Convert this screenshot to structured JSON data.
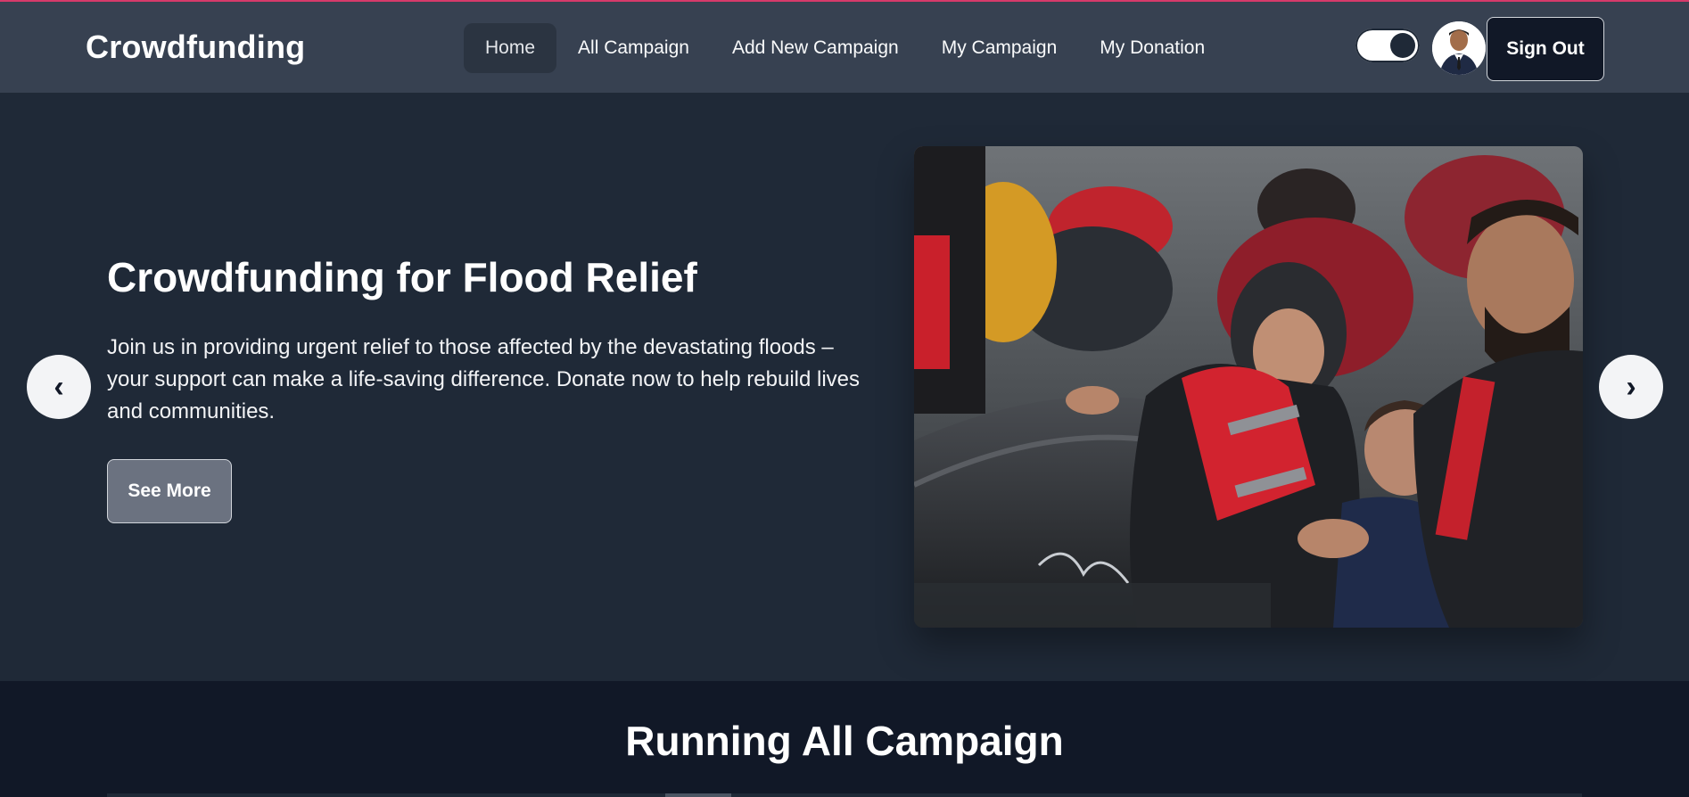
{
  "navbar": {
    "brand": "Crowdfunding",
    "links": [
      {
        "label": "Home",
        "active": true
      },
      {
        "label": "All Campaign",
        "active": false
      },
      {
        "label": "Add New Campaign",
        "active": false
      },
      {
        "label": "My Campaign",
        "active": false
      },
      {
        "label": "My Donation",
        "active": false
      }
    ],
    "theme_toggle_icon": "toggle-switch-icon",
    "avatar_icon": "user-avatar",
    "sign_out_label": "Sign Out"
  },
  "hero": {
    "title": "Crowdfunding for Flood Relief",
    "description": "Join us in providing urgent relief to those affected by the devastating floods – your support can make a life-saving difference. Donate now to help rebuild lives and communities.",
    "button_label": "See More",
    "prev_arrow": "‹",
    "next_arrow": "›",
    "image_icon": "flood-rescue-photo"
  },
  "section": {
    "title": "Running All Campaign"
  },
  "colors": {
    "accent_top_line": "#d63a6a",
    "navbar_bg": "#374151",
    "hero_bg": "#1f2937",
    "section_bg": "#111827"
  }
}
